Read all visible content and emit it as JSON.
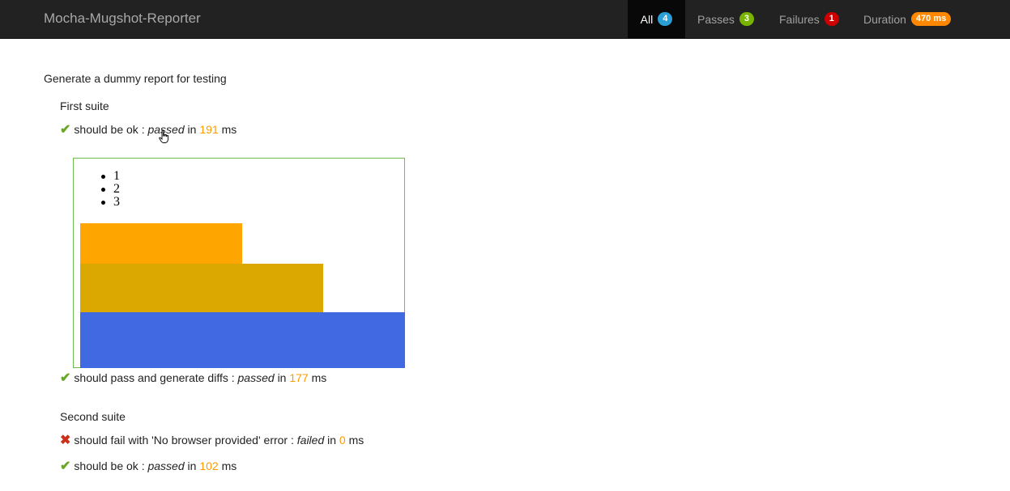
{
  "navbar": {
    "brand": "Mocha-Mugshot-Reporter",
    "tabs": [
      {
        "label": "All",
        "count": "4",
        "color": "#2a9fd6"
      },
      {
        "label": "Passes",
        "count": "3",
        "color": "#77b300"
      },
      {
        "label": "Failures",
        "count": "1",
        "color": "#cc0000"
      },
      {
        "label": "Duration",
        "count": "470 ms",
        "color": "#ff8800"
      }
    ]
  },
  "report": {
    "title": "Generate a dummy report for testing",
    "suites": [
      {
        "title": "First suite",
        "tests": [
          {
            "icon": "check-icon",
            "name": "should be ok",
            "status": "passed",
            "in": "in",
            "duration": "191",
            "unit": "ms"
          },
          {
            "icon": "check-icon",
            "name": "should pass and generate diffs",
            "status": "passed",
            "in": "in",
            "duration": "177",
            "unit": "ms"
          }
        ]
      },
      {
        "title": "Second suite",
        "tests": [
          {
            "icon": "cross-icon",
            "name": "should fail with 'No browser provided' error",
            "status": "failed",
            "in": "in",
            "duration": "0",
            "unit": "ms"
          },
          {
            "icon": "check-icon",
            "name": "should be ok",
            "status": "passed",
            "in": "in",
            "duration": "102",
            "unit": "ms"
          }
        ]
      }
    ]
  },
  "diff_preview": {
    "list_items": [
      "1",
      "2",
      "3"
    ],
    "bar_colors": [
      "#ffa500",
      "#daa800",
      "#4169e1"
    ],
    "border_color": "#6cc04a"
  },
  "colors": {
    "navbar_bg": "#222222",
    "active_tab_bg": "#080808",
    "duration_text": "#ff9900",
    "pass_icon": "#6aa728",
    "fail_icon": "#cc2f1a"
  }
}
